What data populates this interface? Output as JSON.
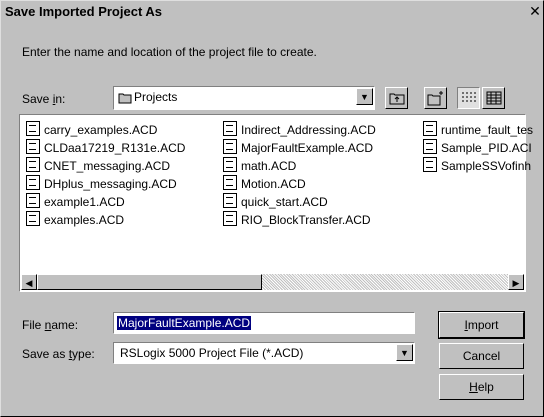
{
  "title": "Save Imported Project As",
  "close_symbol": "✕",
  "prompt": "Enter the name and location of the project file to create.",
  "save_in": {
    "label_pre": "Save ",
    "label_u": "i",
    "label_post": "n:",
    "value": "Projects"
  },
  "icons": [
    "folder-icon",
    "up-folder-icon",
    "new-folder-icon",
    "list-view-icon",
    "details-view-icon",
    "acd-file-icon"
  ],
  "files": [
    "carry_examples.ACD",
    "CLDaa17219_R131e.ACD",
    "CNET_messaging.ACD",
    "DHplus_messaging.ACD",
    "example1.ACD",
    "examples.ACD",
    "Indirect_Addressing.ACD",
    "MajorFaultExample.ACD",
    "math.ACD",
    "Motion.ACD",
    "quick_start.ACD",
    "RIO_BlockTransfer.ACD",
    "runtime_fault_tes",
    "Sample_PID.ACI",
    "SampleSSVofinh"
  ],
  "file_name": {
    "label_pre": "File ",
    "label_u": "n",
    "label_post": "ame:",
    "value": "MajorFaultExample.ACD"
  },
  "save_as_type": {
    "label_pre": "Save as ",
    "label_u": "t",
    "label_post": "ype:",
    "value": "RSLogix 5000 Project File (*.ACD)"
  },
  "buttons": {
    "import": {
      "u": "I",
      "rest": "mport"
    },
    "cancel": "Cancel",
    "help": {
      "u": "H",
      "rest": "elp"
    }
  }
}
